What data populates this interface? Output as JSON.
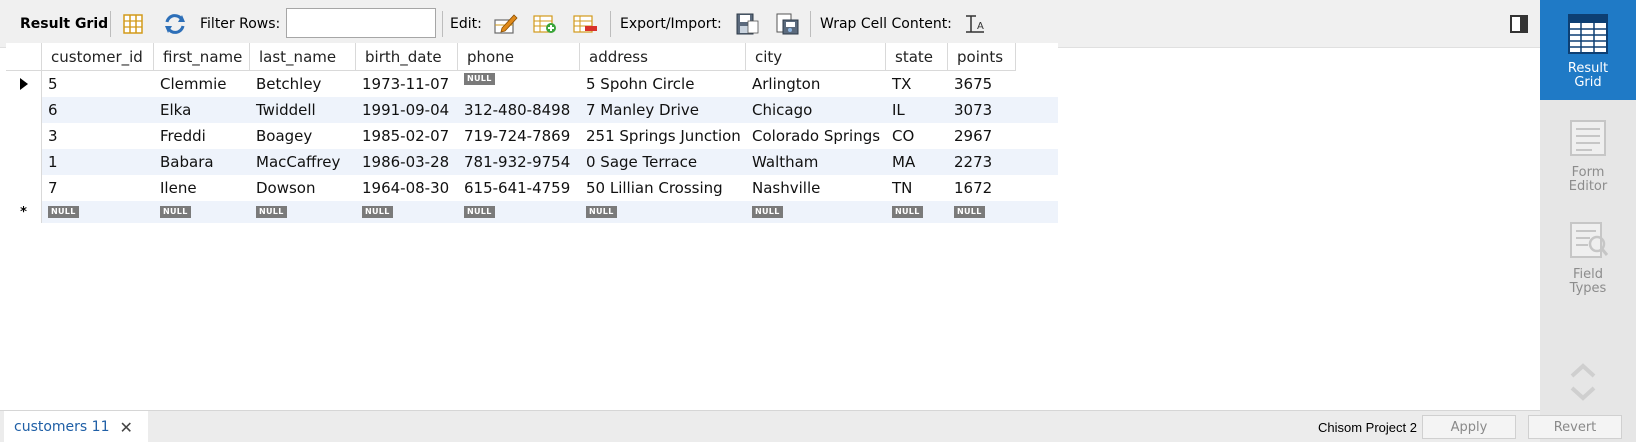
{
  "toolbar": {
    "result_grid_label": "Result Grid",
    "filter_rows_label": "Filter Rows:",
    "filter_value": "",
    "edit_label": "Edit:",
    "export_import_label": "Export/Import:",
    "wrap_label": "Wrap Cell Content:"
  },
  "grid": {
    "columns": [
      "customer_id",
      "first_name",
      "last_name",
      "birth_date",
      "phone",
      "address",
      "city",
      "state",
      "points"
    ],
    "rows": [
      [
        "5",
        "Clemmie",
        "Betchley",
        "1973-11-07",
        "NULL",
        "5 Spohn Circle",
        "Arlington",
        "TX",
        "3675"
      ],
      [
        "6",
        "Elka",
        "Twiddell",
        "1991-09-04",
        "312-480-8498",
        "7 Manley Drive",
        "Chicago",
        "IL",
        "3073"
      ],
      [
        "3",
        "Freddi",
        "Boagey",
        "1985-02-07",
        "719-724-7869",
        "251 Springs Junction",
        "Colorado Springs",
        "CO",
        "2967"
      ],
      [
        "1",
        "Babara",
        "MacCaffrey",
        "1986-03-28",
        "781-932-9754",
        "0 Sage Terrace",
        "Waltham",
        "MA",
        "2273"
      ],
      [
        "7",
        "Ilene",
        "Dowson",
        "1964-08-30",
        "615-641-4759",
        "50 Lillian Crossing",
        "Nashville",
        "TN",
        "1672"
      ]
    ],
    "null_label": "NULL",
    "new_row_marker": "*"
  },
  "side_panel": {
    "result_grid": "Result\nGrid",
    "form_editor": "Form\nEditor",
    "field_types": "Field\nTypes"
  },
  "bottom": {
    "tab_label": "customers 11",
    "tab_close": "✕",
    "connection": "Chisom Project 2",
    "apply": "Apply",
    "revert": "Revert"
  },
  "colors": {
    "accent": "#1f7ac6",
    "row_alt": "#eef3fb",
    "null_badge": "#7a7a7a"
  }
}
